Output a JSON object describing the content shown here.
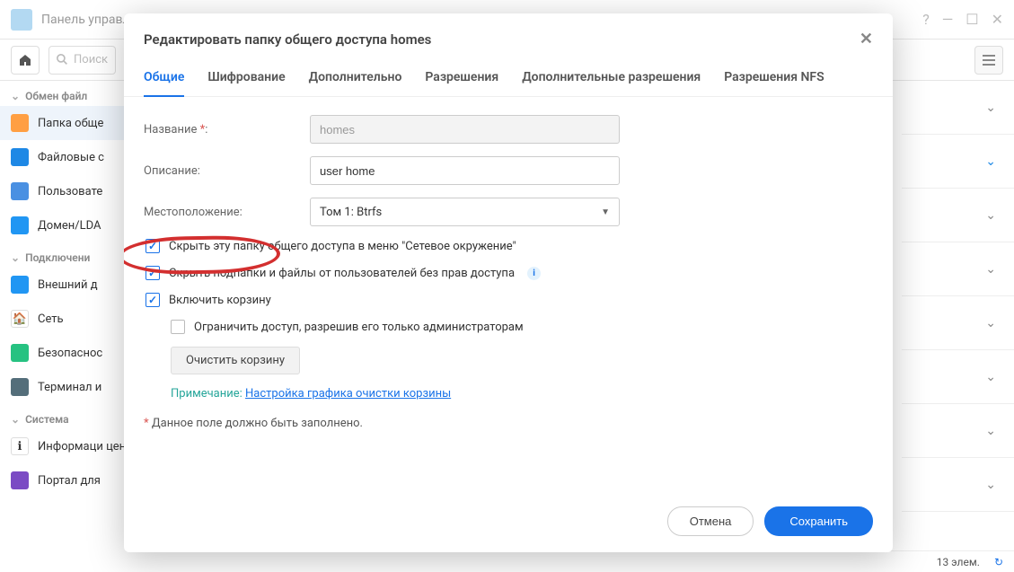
{
  "window": {
    "title": "Панель управления"
  },
  "toolbar": {
    "search_placeholder": "Поиск"
  },
  "sidebar": {
    "groups": [
      {
        "label": "Обмен файл"
      },
      {
        "label": "Подключени"
      },
      {
        "label": "Система"
      }
    ],
    "items": {
      "shared_folder": "Папка обще",
      "file_services": "Файловые с",
      "user": "Пользовате",
      "domain": "Домен/LDA",
      "external": "Внешний д",
      "network": "Сеть",
      "security": "Безопаснос",
      "terminal": "Терминал и",
      "info": "Информаци центр",
      "portal": "Портал для"
    }
  },
  "statusbar": {
    "count": "13 элем."
  },
  "dialog": {
    "title": "Редактировать папку общего доступа homes",
    "tabs": {
      "general": "Общие",
      "encryption": "Шифрование",
      "advanced": "Дополнительно",
      "permissions": "Разрешения",
      "adv_permissions": "Дополнительные разрешения",
      "nfs_permissions": "Разрешения NFS"
    },
    "form": {
      "name_label": "Название",
      "name_value": "homes",
      "desc_label": "Описание:",
      "desc_value": "user home",
      "location_label": "Местоположение:",
      "location_value": "Том 1:  Btrfs",
      "hide_network": "Скрыть эту папку общего доступа в меню \"Сетевое окружение\"",
      "hide_subfolders": "Скрыть подпапки и файлы от пользователей без прав доступа",
      "enable_recycle": "Включить корзину",
      "restrict_admin": "Ограничить доступ, разрешив его только администраторам",
      "empty_recycle_btn": "Очистить корзину",
      "note_label": "Примечание:",
      "note_link": "Настройка графика очистки корзины",
      "required_note": "Данное поле должно быть заполнено."
    },
    "buttons": {
      "cancel": "Отмена",
      "save": "Сохранить"
    }
  }
}
